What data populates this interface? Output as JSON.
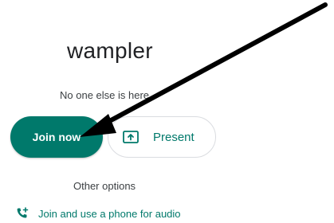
{
  "meeting": {
    "title": "wampler",
    "status": "No one else is here"
  },
  "actions": {
    "join_label": "Join now",
    "present_label": "Present",
    "present_icon": "present-screen-icon"
  },
  "links": {
    "other_options": "Other options",
    "phone_audio": "Join and use a phone for audio",
    "phone_icon": "phone-add-icon"
  },
  "colors": {
    "accent": "#00796b",
    "annotation_arrow": "#000000"
  }
}
